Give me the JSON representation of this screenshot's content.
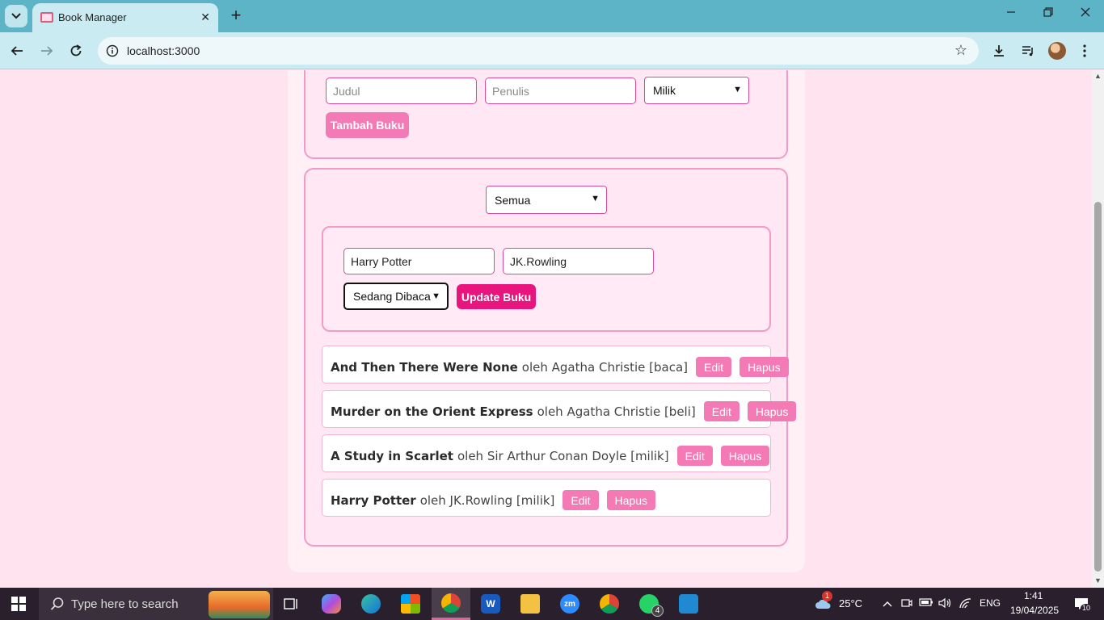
{
  "browser": {
    "tab_title": "Book Manager",
    "url": "localhost:3000",
    "new_tab": "+",
    "tab_close": "✕"
  },
  "add_form": {
    "title_placeholder": "Judul",
    "author_placeholder": "Penulis",
    "status_selected": "Milik",
    "add_button": "Tambah Buku"
  },
  "filter": {
    "selected": "Semua"
  },
  "edit_form": {
    "title_value": "Harry Potter",
    "author_value": "JK.Rowling",
    "status_selected": "Sedang Dibaca",
    "update_button": "Update Buku"
  },
  "books": [
    {
      "title": "And Then There Were None",
      "meta": "oleh Agatha Christie [baca]",
      "edit": "Edit",
      "delete": "Hapus"
    },
    {
      "title": "Murder on the Orient Express",
      "meta": "oleh Agatha Christie [beli]",
      "edit": "Edit",
      "delete": "Hapus"
    },
    {
      "title": "A Study in Scarlet",
      "meta": "oleh Sir Arthur Conan Doyle [milik]",
      "edit": "Edit",
      "delete": "Hapus"
    },
    {
      "title": "Harry Potter",
      "meta": "oleh JK.Rowling [milik]",
      "edit": "Edit",
      "delete": "Hapus"
    }
  ],
  "taskbar": {
    "search_placeholder": "Type here to search",
    "temperature": "25°C",
    "language": "ENG",
    "time": "1:41",
    "date": "19/04/2025",
    "whatsapp_badge": "4",
    "notification_count": "10",
    "weather_alert": "1"
  },
  "colors": {
    "page_bg": "#ffe4f0",
    "accent_pink": "#f47ab5",
    "update_pink": "#e8157e",
    "border_pink": "#f49ac7",
    "browser_frame": "#5db4c6"
  }
}
